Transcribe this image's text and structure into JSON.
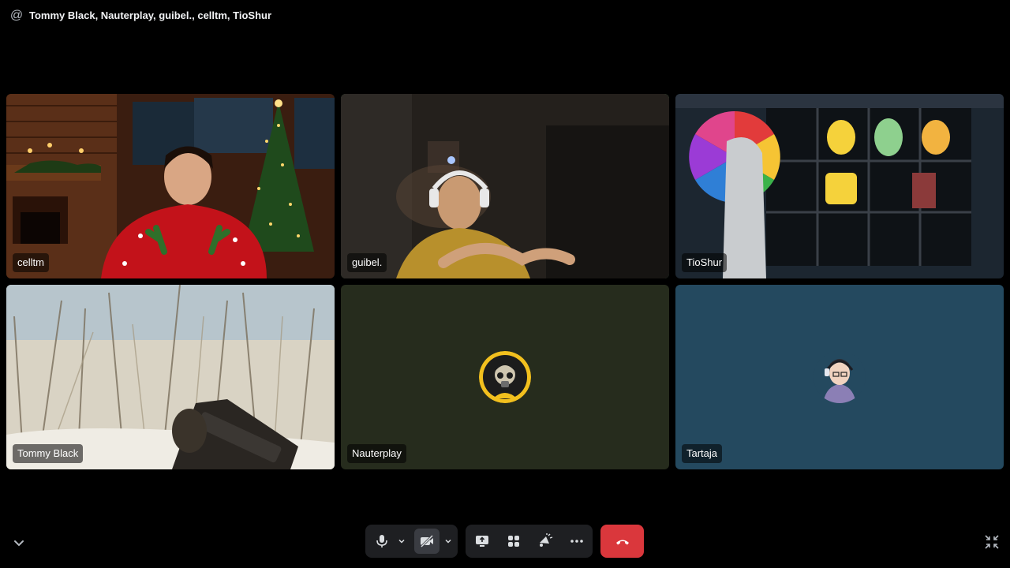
{
  "header": {
    "icon": "at-icon",
    "participants_title": "Tommy Black, Nauterplay, guibel., celltm, TioShur"
  },
  "tiles": [
    {
      "name": "celltm",
      "type": "video",
      "speaking": false
    },
    {
      "name": "guibel.",
      "type": "video",
      "speaking": true
    },
    {
      "name": "TioShur",
      "type": "video",
      "speaking": false
    },
    {
      "name": "Tommy Black",
      "type": "screen-share",
      "speaking": false
    },
    {
      "name": "Nauterplay",
      "type": "avatar",
      "speaking": false,
      "bg_color": "#262c1d"
    },
    {
      "name": "Tartaja",
      "type": "avatar",
      "speaking": false,
      "bg_color": "#24495f"
    }
  ],
  "controls": {
    "icons": [
      "microphone-icon",
      "chevron-down-icon",
      "camera-off-icon",
      "chevron-down-icon",
      "screen-share-icon",
      "activities-icon",
      "soundboard-icon",
      "more-icon",
      "hang-up-icon"
    ],
    "hangup_color": "#da373c"
  },
  "colors": {
    "speaking_border": "#43a25a",
    "control_bg": "#1e1f22"
  }
}
